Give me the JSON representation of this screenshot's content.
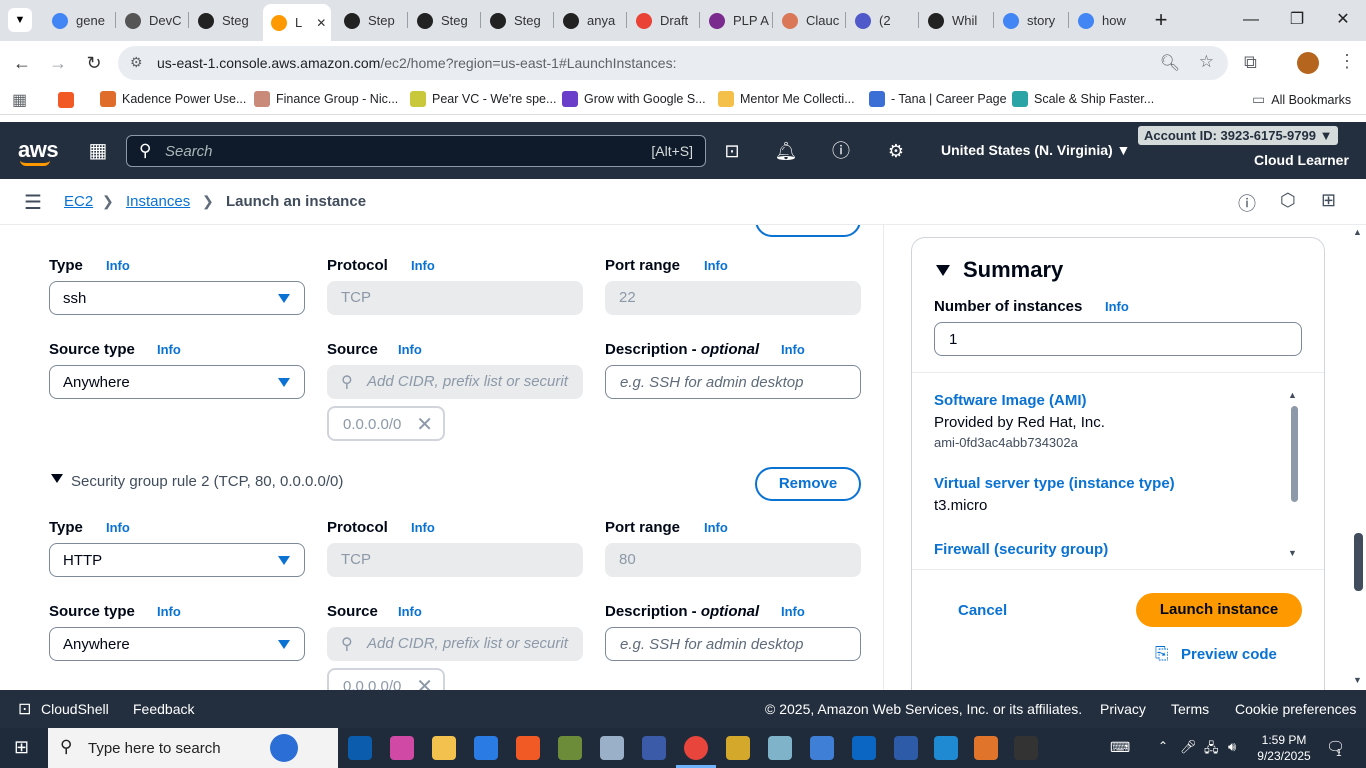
{
  "browser": {
    "tabs": [
      {
        "label": "gene",
        "icon": "google-icon",
        "color": "#4285f4"
      },
      {
        "label": "DevC",
        "icon": "devc-icon",
        "color": "#555555"
      },
      {
        "label": "Steg",
        "icon": "github-icon",
        "color": "#222222"
      },
      {
        "label": "L",
        "icon": "aws-icon",
        "color": "#ff9900",
        "active": true
      },
      {
        "label": "Step",
        "icon": "openai-icon",
        "color": "#222222"
      },
      {
        "label": "Steg",
        "icon": "github-icon",
        "color": "#222222"
      },
      {
        "label": "Steg",
        "icon": "github-icon",
        "color": "#222222"
      },
      {
        "label": "anya",
        "icon": "github-icon",
        "color": "#222222"
      },
      {
        "label": "Draft",
        "icon": "gmail-icon",
        "color": "#ea4335"
      },
      {
        "label": "PLP A",
        "icon": "plp-icon",
        "color": "#7b2a8e"
      },
      {
        "label": "Clauc",
        "icon": "claude-icon",
        "color": "#d97757"
      },
      {
        "label": "(2",
        "icon": "teams-icon",
        "color": "#5059c9"
      },
      {
        "label": "Whil",
        "icon": "openai-icon",
        "color": "#222222"
      },
      {
        "label": "story",
        "icon": "google-icon",
        "color": "#4285f4"
      },
      {
        "label": "how",
        "icon": "google-icon",
        "color": "#4285f4"
      }
    ],
    "url_host": "us-east-1.console.aws.amazon.com",
    "url_path": "/ec2/home?region=us-east-1#LaunchInstances:",
    "bookmarks": [
      {
        "label": "Kadence Power Use...",
        "color": "#e06c2b"
      },
      {
        "label": "Finance Group - Nic...",
        "color": "#c98a7a"
      },
      {
        "label": "Pear VC - We're spe...",
        "color": "#c8c83a"
      },
      {
        "label": "Grow with Google S...",
        "color": "#6a3ec9"
      },
      {
        "label": "Mentor Me Collecti...",
        "color": "#f5c04a"
      },
      {
        "label": "- Tana | Career Page",
        "color": "#3b6fd6"
      },
      {
        "label": "Scale & Ship Faster...",
        "color": "#2aa4a4"
      }
    ],
    "all_bookmarks": "All Bookmarks"
  },
  "aws": {
    "logo": "aws",
    "search_placeholder": "Search",
    "search_shortcut": "[Alt+S]",
    "region": "United States (N. Virginia) ▼",
    "account": "Account ID: 3923-6175-9799 ▼",
    "user": "Cloud Learner",
    "brand_color": "#232f3e"
  },
  "breadcrumb": {
    "ec2": "EC2",
    "instances": "Instances",
    "current": "Launch an instance"
  },
  "form": {
    "info": "Info",
    "remove": "Remove",
    "type_label": "Type",
    "protocol_label": "Protocol",
    "port_range_label": "Port range",
    "source_type_label": "Source type",
    "source_label": "Source",
    "description_label": "Description - ",
    "description_optional": "optional",
    "source_placeholder": "Add CIDR, prefix list or securit",
    "description_placeholder": "e.g. SSH for admin desktop",
    "rule1": {
      "type": "ssh",
      "protocol": "TCP",
      "port": "22",
      "source_type": "Anywhere",
      "cidr": "0.0.0.0/0"
    },
    "rule2": {
      "header": "Security group rule 2 (TCP, 80, 0.0.0.0/0)",
      "type": "HTTP",
      "protocol": "TCP",
      "port": "80",
      "source_type": "Anywhere",
      "cidr": "0.0.0.0/0"
    }
  },
  "summary": {
    "title": "Summary",
    "num_instances_label": "Number of instances",
    "num_instances": "1",
    "ami_label": "Software Image (AMI)",
    "ami_provider": "Provided by Red Hat, Inc.",
    "ami_id": "ami-0fd3ac4abb734302a",
    "instance_type_label": "Virtual server type (instance type)",
    "instance_type": "t3.micro",
    "firewall_label": "Firewall (security group)",
    "cancel": "Cancel",
    "launch": "Launch instance",
    "preview": "Preview code"
  },
  "footer": {
    "cloudshell": "CloudShell",
    "feedback": "Feedback",
    "copyright": "© 2025, Amazon Web Services, Inc. or its affiliates.",
    "privacy": "Privacy",
    "terms": "Terms",
    "cookies": "Cookie preferences"
  },
  "taskbar": {
    "search_placeholder": "Type here to search",
    "time": "1:59 PM",
    "date": "9/23/2025",
    "notification_count": "1"
  }
}
